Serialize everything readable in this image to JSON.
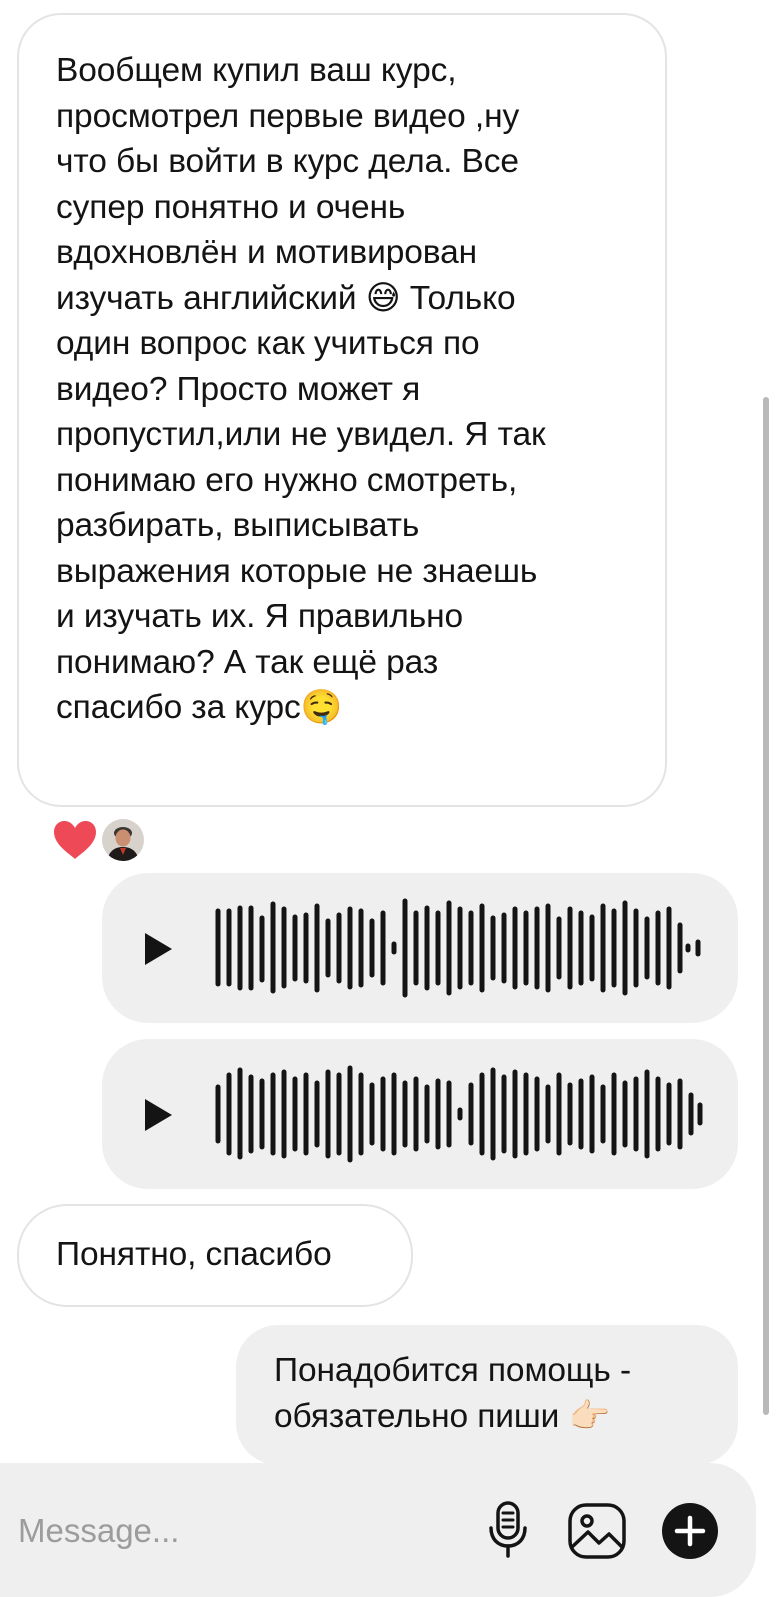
{
  "messages": {
    "incoming_long": {
      "text": "Вообщем купил ваш курс,\nпросмотрел первые видео ,ну\nчто бы войти в курс дела. Все\nсупер понятно и очень\nвдохновлён и мотивирован\nизучать английский 😅 Только\nодин вопрос как учиться по\nвидео? Просто может я\nпропустил,или не увидел. Я так\nпонимаю его нужно смотреть,\nразбирать, выписывать\nвыражения которые не знаешь\nи изучать их. Я правильно\nпонимаю? А так ещё раз\nспасибо за курс🤤"
    },
    "reactions": [
      {
        "icon": "heart-icon",
        "color": "#ed4956"
      },
      {
        "icon": "avatar"
      }
    ],
    "voice_messages": [
      {
        "icon": "play-icon"
      },
      {
        "icon": "play-icon"
      }
    ],
    "incoming_short": {
      "text": "Понятно, спасибо"
    },
    "outgoing": {
      "text": "Понадобится помощь -\nобязательно пиши 👉🏻"
    }
  },
  "composer": {
    "placeholder": "Message...",
    "icons": [
      "microphone-icon",
      "gallery-icon",
      "add-icon"
    ]
  },
  "colors": {
    "bubble_gray": "#efefef",
    "bubble_border": "#e4e4e4",
    "text": "#141414",
    "placeholder": "#9c9c9c",
    "heart": "#ed4956"
  }
}
